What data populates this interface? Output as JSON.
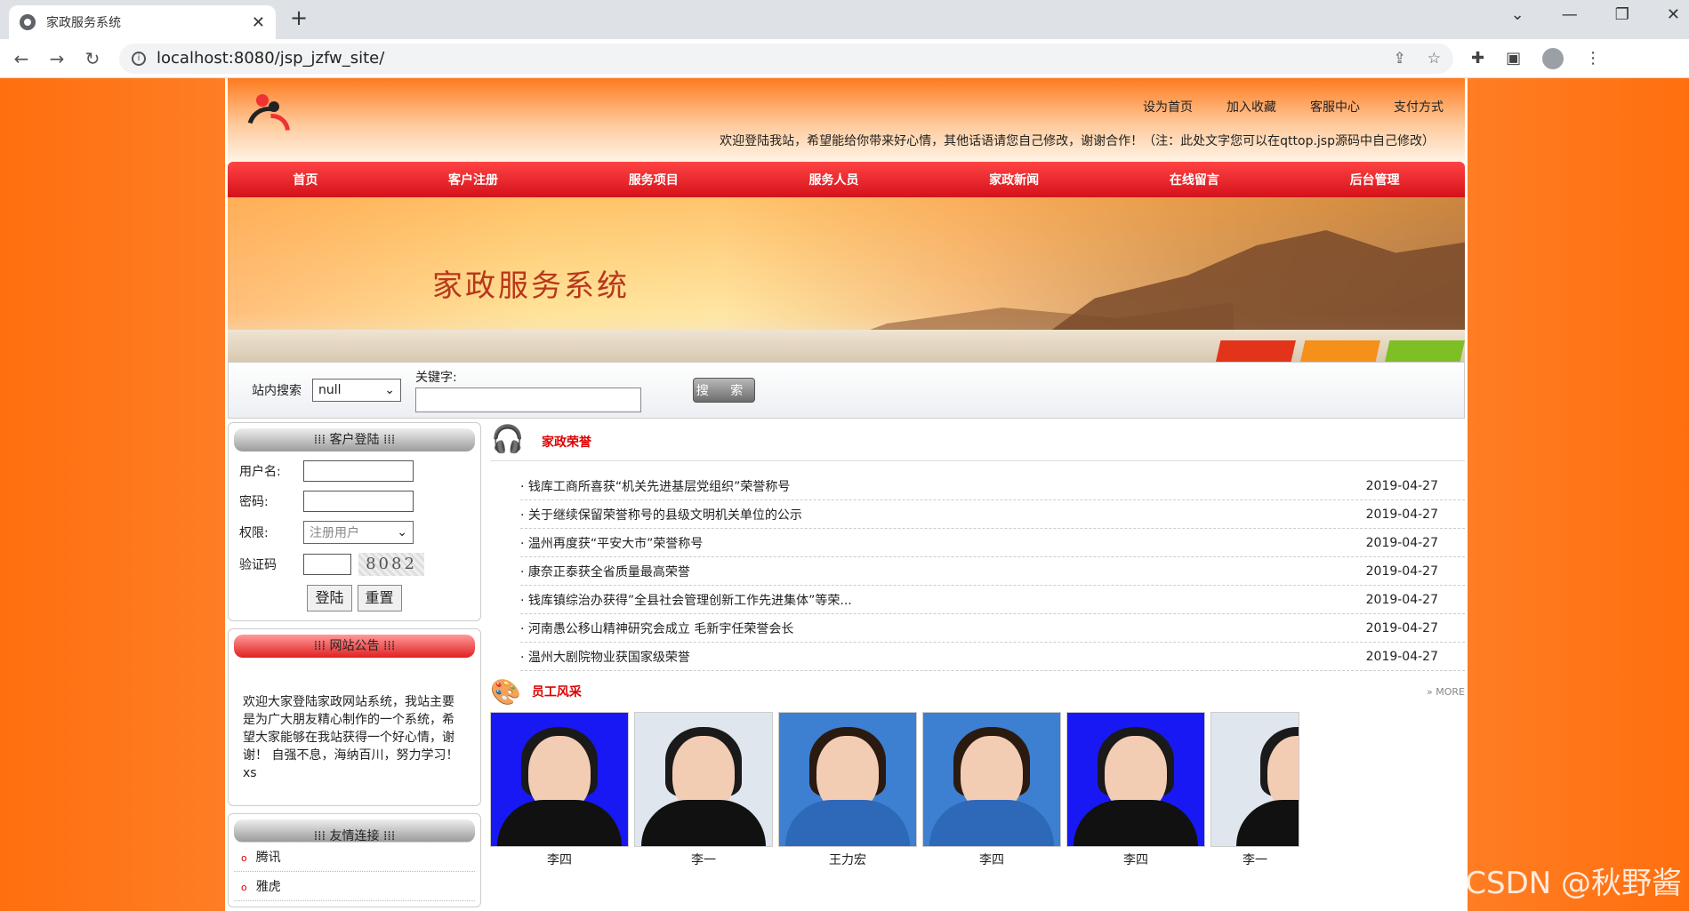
{
  "browser": {
    "tab_title": "家政服务系统",
    "url": "localhost:8080/jsp_jzfw_site/"
  },
  "header": {
    "top_links": [
      "设为首页",
      "加入收藏",
      "客服中心",
      "支付方式"
    ],
    "welcome": "欢迎登陆我站，希望能给你带来好心情，其他话语请您自己修改，谢谢合作！（注：此处文字您可以在qttop.jsp源码中自己修改）"
  },
  "menu": [
    "首页",
    "客户注册",
    "服务项目",
    "服务人员",
    "家政新闻",
    "在线留言",
    "后台管理"
  ],
  "banner": {
    "title": "家政服务系统"
  },
  "search": {
    "label": "站内搜索",
    "select_value": "null",
    "keyword_label": "关键字:",
    "button": "搜 索"
  },
  "login": {
    "header": "客户登陆",
    "username_label": "用户名:",
    "password_label": "密码:",
    "role_label": "权限:",
    "role_value": "注册用户",
    "captcha_label": "验证码",
    "captcha_value": "8082",
    "login_btn": "登陆",
    "reset_btn": "重置"
  },
  "notice": {
    "header": "网站公告",
    "text": "欢迎大家登陆家政网站系统，我站主要是为广大朋友精心制作的一个系统，希望大家能够在我站获得一个好心情，谢谢！ 自强不息，海纳百川，努力学习！xs"
  },
  "friends": {
    "header": "友情连接",
    "items": [
      "腾讯",
      "雅虎"
    ]
  },
  "honor": {
    "title": "家政荣誉",
    "items": [
      {
        "title": "钱库工商所喜获“机关先进基层党组织”荣誉称号",
        "date": "2019-04-27"
      },
      {
        "title": "关于继续保留荣誉称号的县级文明机关单位的公示",
        "date": "2019-04-27"
      },
      {
        "title": "温州再度获“平安大市”荣誉称号",
        "date": "2019-04-27"
      },
      {
        "title": "康奈正泰获全省质量最高荣誉",
        "date": "2019-04-27"
      },
      {
        "title": "钱库镇综治办获得”全县社会管理创新工作先进集体”等荣...",
        "date": "2019-04-27"
      },
      {
        "title": "河南愚公移山精神研究会成立 毛新宇任荣誉会长",
        "date": "2019-04-27"
      },
      {
        "title": "温州大剧院物业获国家级荣誉",
        "date": "2019-04-27"
      }
    ]
  },
  "staff": {
    "title": "员工风采",
    "more": "MORE",
    "items": [
      {
        "name": "李四",
        "bg": "blue"
      },
      {
        "name": "李一",
        "bg": "white"
      },
      {
        "name": "王力宏",
        "bg": "lblue"
      },
      {
        "name": "李四",
        "bg": "lblue"
      },
      {
        "name": "李四",
        "bg": "blue"
      },
      {
        "name": "李一",
        "bg": "white"
      }
    ]
  },
  "watermark": "CSDN @秋野酱"
}
